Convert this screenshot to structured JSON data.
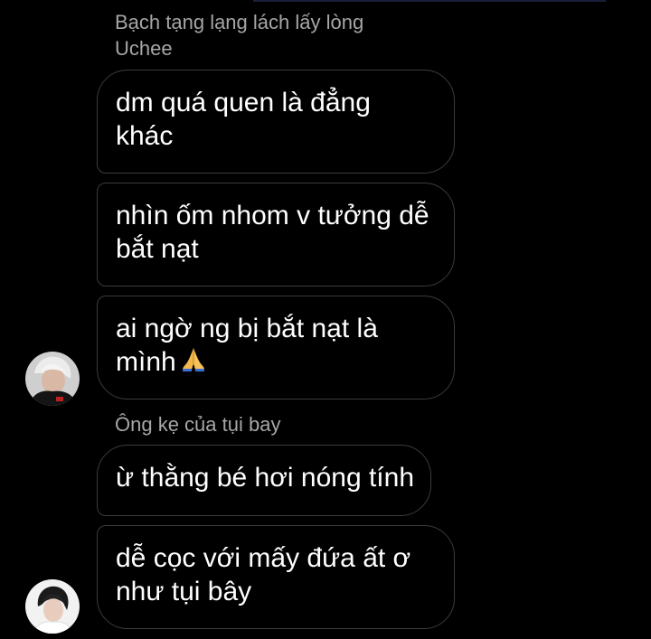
{
  "group1": {
    "sender_line1": "Bạch tạng lạng lách lấy lòng",
    "sender_line2": "Uchee",
    "messages": [
      {
        "line1": "dm quá quen là đẳng",
        "line2": "khác"
      },
      {
        "line1": "nhìn ốm nhom v tưởng dễ",
        "line2": "bắt nạt"
      },
      {
        "line1": "ai ngờ ng bị bắt nạt là",
        "line2": "mình",
        "emoji": "folded-hands-icon"
      }
    ],
    "avatar": "user-avatar-1"
  },
  "group2": {
    "sender": "Ông kẹ của tụi bay",
    "messages": [
      {
        "line1": "ừ thằng bé hơi nóng tính"
      },
      {
        "line1": "dễ cọc với mấy đứa ất ơ",
        "line2": "như tụi bây"
      }
    ],
    "avatar": "user-avatar-2"
  },
  "colors": {
    "background": "#000000",
    "bubble_border": "#3b3b3b",
    "message_text": "#ffffff",
    "sender_text": "#a6a6a6"
  }
}
